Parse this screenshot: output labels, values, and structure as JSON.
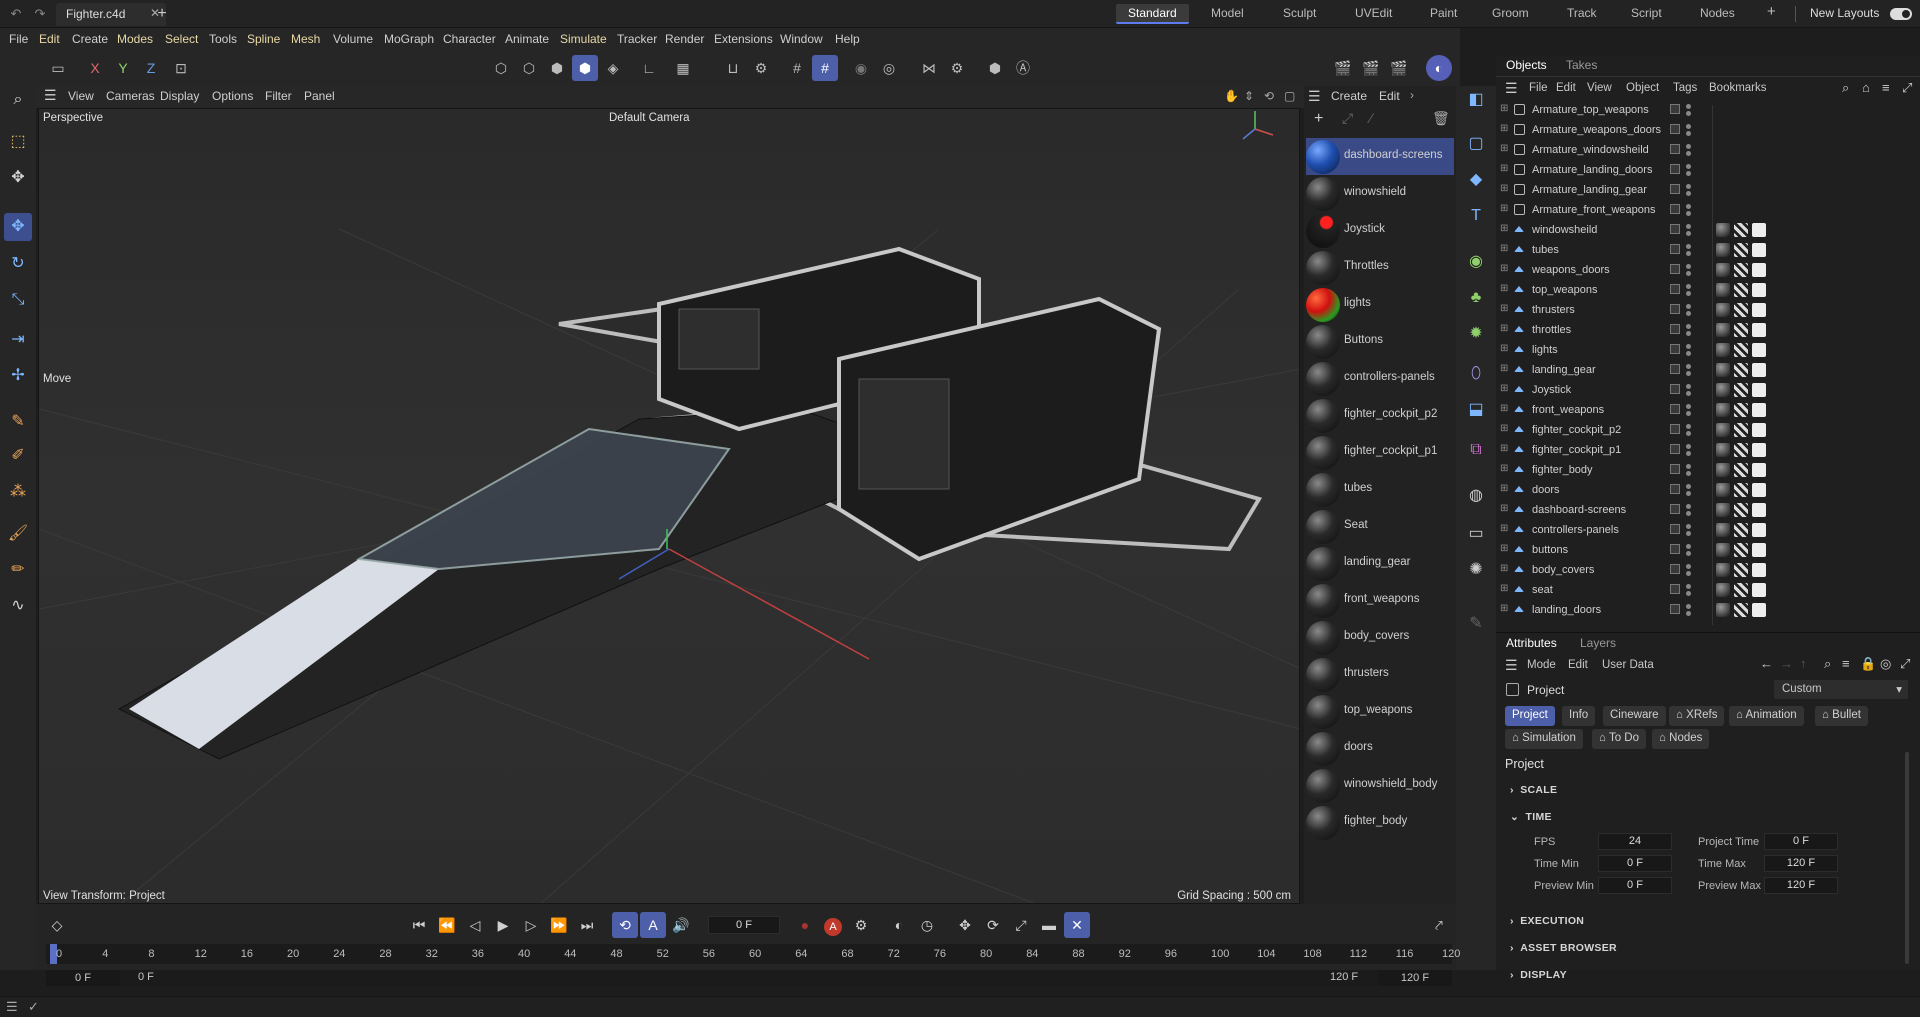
{
  "titlebar": {
    "file_tab": "Fighter.c4d",
    "layouts": [
      "Standard",
      "Model",
      "Sculpt",
      "UVEdit",
      "Paint",
      "Groom",
      "Track",
      "Script",
      "Nodes"
    ],
    "active_layout": "Standard",
    "new_layouts": "New Layouts"
  },
  "menu": [
    "File",
    "Edit",
    "Create",
    "Modes",
    "Select",
    "Tools",
    "Spline",
    "Mesh",
    "Volume",
    "MoGraph",
    "Character",
    "Animate",
    "Simulate",
    "Tracker",
    "Render",
    "Extensions",
    "Window",
    "Help"
  ],
  "toolbar": {
    "axis_x": "X",
    "axis_y": "Y",
    "axis_z": "Z"
  },
  "viewport": {
    "menu": [
      "View",
      "Cameras",
      "Display",
      "Options",
      "Filter",
      "Panel"
    ],
    "name": "Perspective",
    "camera": "Default Camera",
    "tool_label": "Move",
    "view_transform": "View Transform: Project",
    "grid_spacing": "Grid Spacing : 500 cm"
  },
  "materials": {
    "menu": [
      "Create",
      "Edit"
    ],
    "items": [
      "dashboard-screens",
      "winowshield",
      "Joystick",
      "Throttles",
      "lights",
      "Buttons",
      "controllers-panels",
      "fighter_cockpit_p2",
      "fighter_cockpit_p1",
      "tubes",
      "Seat",
      "landing_gear",
      "front_weapons",
      "body_covers",
      "thrusters",
      "top_weapons",
      "doors",
      "winowshield_body",
      "fighter_body"
    ],
    "selected": "dashboard-screens"
  },
  "objects": {
    "tabs": [
      "Objects",
      "Takes"
    ],
    "menu": [
      "File",
      "Edit",
      "View",
      "Object",
      "Tags",
      "Bookmarks"
    ],
    "rows": [
      "Armature_top_weapons",
      "Armature_weapons_doors",
      "Armature_windowsheild",
      "Armature_landing_doors",
      "Armature_landing_gear",
      "Armature_front_weapons",
      "windowsheild",
      "tubes",
      "weapons_doors",
      "top_weapons",
      "thrusters",
      "throttles",
      "lights",
      "landing_gear",
      "Joystick",
      "front_weapons",
      "fighter_cockpit_p2",
      "fighter_cockpit_p1",
      "fighter_body",
      "doors",
      "dashboard-screens",
      "controllers-panels",
      "buttons",
      "body_covers",
      "seat",
      "landing_doors"
    ]
  },
  "attributes": {
    "tabs": [
      "Attributes",
      "Layers"
    ],
    "menu": [
      "Mode",
      "Edit",
      "User Data"
    ],
    "object": "Project",
    "preset": "Custom",
    "buttons_row1": [
      "Project",
      "Info",
      "Cineware",
      "XRefs",
      "Animation",
      "Bullet"
    ],
    "buttons_row2": [
      "Simulation",
      "To Do",
      "Nodes"
    ],
    "heading": "Project",
    "sections": {
      "scale": "SCALE",
      "time": "TIME",
      "execution": "EXECUTION",
      "asset_browser": "ASSET BROWSER",
      "display": "DISPLAY"
    },
    "fields": {
      "fps_label": "FPS",
      "fps": "24",
      "project_time_label": "Project Time",
      "project_time": "0 F",
      "time_min_label": "Time Min",
      "time_min": "0 F",
      "time_max_label": "Time Max",
      "time_max": "120 F",
      "preview_min_label": "Preview Min",
      "preview_min": "0 F",
      "preview_max_label": "Preview Max",
      "preview_max": "120 F"
    }
  },
  "timeline": {
    "current_frame": "0 F",
    "ticks": [
      "0",
      "4",
      "8",
      "12",
      "16",
      "20",
      "24",
      "28",
      "32",
      "36",
      "40",
      "44",
      "48",
      "52",
      "56",
      "60",
      "64",
      "68",
      "72",
      "76",
      "80",
      "84",
      "88",
      "92",
      "96",
      "100",
      "104",
      "108",
      "112",
      "116",
      "120"
    ],
    "range_start": "0 F",
    "range_start2": "0 F",
    "range_end": "120 F",
    "range_end2": "120 F"
  },
  "colors": {
    "accent": "#4c5fa8",
    "panel": "#1f1f1f",
    "viewport": "#2e2e2e"
  }
}
